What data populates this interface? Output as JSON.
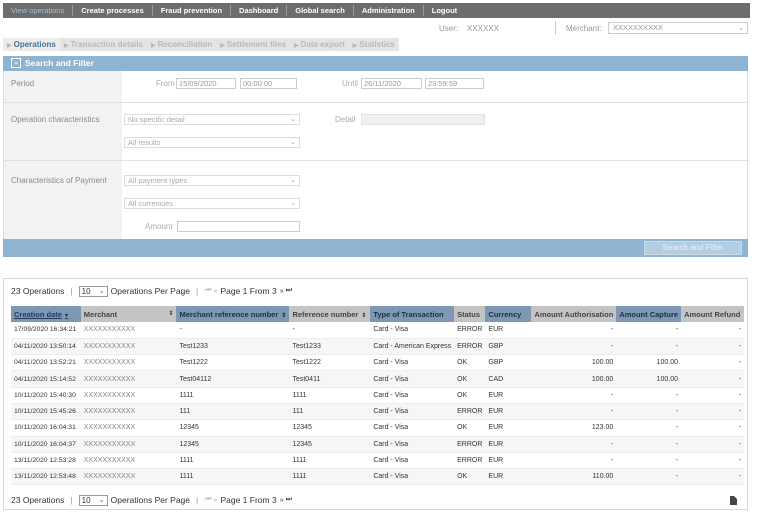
{
  "nav": {
    "items": [
      "View operations",
      "Create processes",
      "Fraud prevention",
      "Dashboard",
      "Global search",
      "Administration",
      "Logout"
    ],
    "active_index": 0
  },
  "userbar": {
    "user_label": "User:",
    "user_value": "XXXXXX",
    "merchant_label": "Merchant:",
    "merchant_value": "XXXXXXXXXX"
  },
  "tabs": [
    "Operations",
    "Transaction details",
    "Reconciliation",
    "Settlement files",
    "Data export",
    "Statistics"
  ],
  "search_panel": {
    "title": "Search and Filter",
    "period_label": "Period",
    "from_label": "From",
    "from_date": "15/09/2020",
    "from_time": "00:00:00",
    "until_label": "Until",
    "until_date": "26/11/2020",
    "until_time": "23:59:59",
    "op_char_label": "Operation characteristics",
    "op_detail_select": "No specific detail",
    "detail_label": "Detail",
    "results_select": "All results",
    "payment_char_label": "Characteristics of Payment",
    "payment_types_select": "All payment types",
    "currencies_select": "All currencies",
    "amount_label": "Amount",
    "search_button": "Search and Filter"
  },
  "results": {
    "count_text": "23 Operations",
    "per_page_value": "10",
    "per_page_label": "Operations Per Page",
    "page_text": "Page 1 From 3",
    "columns": [
      "Creation date",
      "Merchant",
      "Merchant reference number",
      "Reference number",
      "Type of Transaction",
      "Status",
      "Currency",
      "Amount Authorisation",
      "Amount Capture",
      "Amount Refund"
    ],
    "rows": [
      [
        "17/09/2020 16:34:21",
        "XXXXXXXXXXX",
        "-",
        "-",
        "Card - Visa",
        "ERROR",
        "EUR",
        "-",
        "-",
        "-"
      ],
      [
        "04/11/2020 13:50:14",
        "XXXXXXXXXXX",
        "Test1233",
        "Test1233",
        "Card - American Express",
        "ERROR",
        "GBP",
        "-",
        "-",
        "-"
      ],
      [
        "04/11/2020 13:52:21",
        "XXXXXXXXXXX",
        "Test1222",
        "Test1222",
        "Card - Visa",
        "OK",
        "GBP",
        "100.00",
        "100.00",
        "-"
      ],
      [
        "04/11/2020 15:14:52",
        "XXXXXXXXXXX",
        "Test04112",
        "Test0411",
        "Card - Visa",
        "OK",
        "CAD",
        "100.00",
        "100.00",
        "-"
      ],
      [
        "10/11/2020 15:40:30",
        "XXXXXXXXXXX",
        "1111",
        "1111",
        "Card - Visa",
        "OK",
        "EUR",
        "-",
        "-",
        "-"
      ],
      [
        "10/11/2020 15:45:26",
        "XXXXXXXXXXX",
        "111",
        "111",
        "Card - Visa",
        "ERROR",
        "EUR",
        "-",
        "-",
        "-"
      ],
      [
        "10/11/2020 16:04:31",
        "XXXXXXXXXXX",
        "12345",
        "12345",
        "Card - Visa",
        "OK",
        "EUR",
        "123.00",
        "-",
        "-"
      ],
      [
        "10/11/2020 16:04:37",
        "XXXXXXXXXXX",
        "12345",
        "12345",
        "Card - Visa",
        "ERROR",
        "EUR",
        "-",
        "-",
        "-"
      ],
      [
        "13/11/2020 12:53:28",
        "XXXXXXXXXXX",
        "1111",
        "1111",
        "Card - Visa",
        "ERROR",
        "EUR",
        "-",
        "-",
        "-"
      ],
      [
        "13/11/2020 12:53:48",
        "XXXXXXXXXXX",
        "1111",
        "1111",
        "Card - Visa",
        "OK",
        "EUR",
        "110.00",
        "-",
        "-"
      ]
    ]
  }
}
